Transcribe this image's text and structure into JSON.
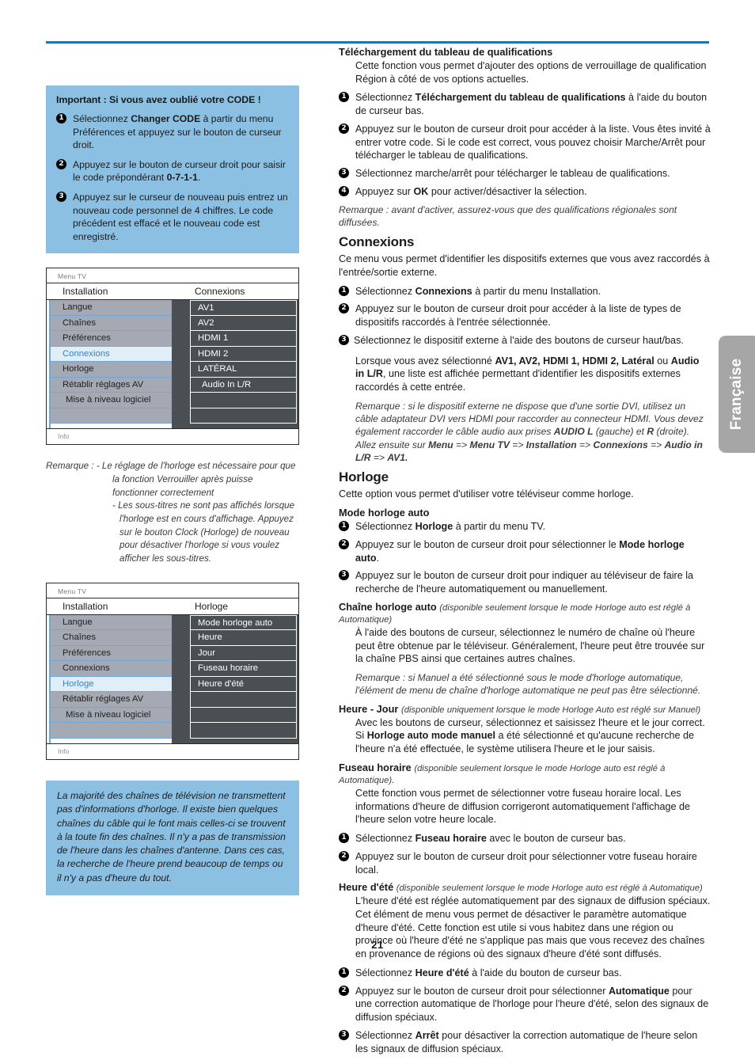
{
  "page": {
    "number": "21",
    "side_tab": "Française"
  },
  "left_column": {
    "code_box": {
      "title": "Important : Si vous avez oublié votre CODE !",
      "steps": [
        "Sélectionnez <b>Changer CODE</b> à partir du menu Préférences et appuyez sur le bouton de curseur droit.",
        "Appuyez sur le bouton de curseur droit pour saisir le code prépondérant <b>0-7-1-1</b>.",
        "Appuyez sur le curseur de nouveau puis entrez un nouveau code personnel de 4 chiffres. Le code précédent est effacé et le nouveau code est enregistré."
      ]
    },
    "menu_connexions": {
      "top_label": "Menu TV",
      "header_left": "Installation",
      "header_right": "Connexions",
      "left_items": [
        "Langue",
        "Chaînes",
        "Préférences",
        "Connexions",
        "Horloge",
        "Rétablir réglages AV",
        "Mise à niveau logiciel",
        ""
      ],
      "selected_left": "Connexions",
      "right_items": [
        "AV1",
        "AV2",
        "HDMI 1",
        "HDMI 2",
        "LATÉRAL",
        "Audio In L/R",
        "",
        ""
      ],
      "bottom_label": "Info"
    },
    "clock_note": {
      "label": "Remarque :",
      "items": [
        "- Le réglage de l'horloge est nécessaire pour que la fonction Verrouiller après puisse fonctionner correctement",
        "- Les sous-titres ne sont pas affichés lorsque l'horloge est en cours d'affichage. Appuyez sur le bouton Clock (Horloge) de nouveau pour désactiver l'horloge si vous voulez afficher les sous-titres."
      ]
    },
    "menu_horloge": {
      "top_label": "Menu TV",
      "header_left": "Installation",
      "header_right": "Horloge",
      "left_items": [
        "Langue",
        "Chaînes",
        "Préférences",
        "Connexions",
        "Horloge",
        "Rétablir réglages AV",
        "Mise à niveau logiciel",
        ""
      ],
      "selected_left": "Horloge",
      "right_items": [
        "Mode horloge auto",
        "Heure",
        "Jour",
        "Fuseau horaire",
        "Heure d'été",
        "",
        "",
        ""
      ],
      "bottom_label": "Info"
    },
    "broadcast_box": {
      "text": "La majorité des chaînes de télévision ne transmettent pas d'informations d'horloge. Il existe bien quelques chaînes du câble qui le font mais celles-ci se trouvent à la toute fin des chaînes. Il n'y a pas de transmission de l'heure dans les chaînes d'antenne. Dans ces cas, la recherche de l'heure prend beaucoup de temps ou il n'y a pas d'heure du tout."
    }
  },
  "right_column": {
    "ratings": {
      "heading": "Téléchargement du tableau de qualifications",
      "intro": "Cette fonction vous permet d'ajouter des options de verrouillage de qualification Région à côté de vos options actuelles.",
      "steps": [
        "Sélectionnez <b>Téléchargement du tableau de qualifications</b> à l'aide du bouton de curseur bas.",
        "Appuyez sur le bouton de curseur droit pour accéder à la liste. Vous êtes invité à entrer votre code. Si le code est correct, vous pouvez choisir Marche/Arrêt pour télécharger le tableau de qualifications.",
        "Sélectionnez marche/arrêt pour télécharger le tableau de qualifications.",
        "Appuyez sur <b>OK</b> pour activer/désactiver la sélection."
      ],
      "note": "Remarque : avant d'activer, assurez-vous que des qualifications régionales sont diffusées."
    },
    "connexions": {
      "heading": "Connexions",
      "intro": "Ce menu vous permet d'identifier les dispositifs externes que vous avez raccordés à l'entrée/sortie externe.",
      "steps": [
        "Sélectionnez <b>Connexions</b> à partir du menu Installation.",
        "Appuyez sur le bouton de curseur droit pour accéder à la liste de types de dispositifs raccordés à l'entrée sélectionnée.",
        "Sélectionnez le dispositif externe à l'aide des boutons de curseur haut/bas."
      ],
      "body": "Lorsque vous avez sélectionné <b>AV1, AV2, HDMI 1, HDMI 2, Latéral</b> ou <b>Audio in L/R</b>, une liste est affichée permettant d'identifier les dispositifs externes raccordés à cette entrée.",
      "note": "Remarque : si le dispositif externe ne dispose que d'une sortie DVI, utilisez un câble adaptateur DVI vers HDMI pour raccorder au connecteur HDMI. Vous devez également raccorder le câble audio aux prises <b>AUDIO L</b> (gauche) et <b>R</b> (droite). Allez ensuite sur <b>Menu</b> =&gt; <b>Menu TV</b> =&gt; <b>Installation</b> =&gt; <b>Connexions</b> =&gt; <b>Audio in L/R</b> =&gt; <b>AV1.</b>"
    },
    "horloge": {
      "heading": "Horloge",
      "intro": "Cette option vous permet d'utiliser votre téléviseur comme horloge.",
      "mode_auto": {
        "heading": "Mode horloge auto",
        "steps": [
          "Sélectionnez <b>Horloge</b> à partir du menu TV.",
          "Appuyez sur le bouton de curseur droit pour sélectionner le <b>Mode horloge auto</b>.",
          "Appuyez sur le bouton de curseur droit pour indiquer au téléviseur de faire la recherche de l'heure automatiquement ou manuellement."
        ]
      },
      "chaine_auto": {
        "heading": "Chaîne horloge auto",
        "heading_note": "(disponible seulement lorsque le mode Horloge auto est réglé à Automatique)",
        "body": "À l'aide des boutons de curseur, sélectionnez le numéro de chaîne où l'heure peut être obtenue par le téléviseur. Généralement, l'heure peut être trouvée sur la chaîne PBS ainsi que certaines autres chaînes.",
        "note": "Remarque : si Manuel a été sélectionné sous le mode d'horloge automatique, l'élément de menu de chaîne d'horloge automatique ne peut pas être sélectionné."
      },
      "heure_jour": {
        "heading": "Heure - Jour",
        "heading_note": "(disponible uniquement lorsque le mode Horloge Auto est réglé sur Manuel)",
        "body": "Avec les boutons de curseur, sélectionnez et saisissez l'heure et le jour correct. Si <b>Horloge auto mode manuel</b> a été sélectionné et qu'aucune recherche de l'heure n'a été effectuée, le système utilisera l'heure et le jour saisis."
      },
      "fuseau": {
        "heading": "Fuseau horaire",
        "heading_note": "(disponible seulement lorsque le mode Horloge auto est réglé à Automatique).",
        "body": "Cette fonction vous permet de sélectionner votre fuseau horaire local. Les informations d'heure de diffusion corrigeront automatiquement l'affichage de l'heure selon votre heure locale.",
        "steps": [
          "Sélectionnez <b>Fuseau horaire</b> avec le bouton de curseur bas.",
          "Appuyez sur le bouton de curseur droit pour sélectionner votre fuseau horaire local."
        ]
      },
      "heure_ete": {
        "heading": "Heure d'été",
        "heading_note": "(disponible seulement lorsque le mode Horloge auto est réglé à Automatique)",
        "body": "L'heure d'été est réglée automatiquement par des signaux de diffusion spéciaux. Cet élément de menu vous permet de désactiver le paramètre automatique d'heure d'été. Cette fonction est utile si vous habitez dans une région ou province où l'heure d'été ne s'applique pas mais que vous recevez des chaînes en provenance de régions où des signaux d'heure d'été sont diffusés.",
        "steps": [
          "Sélectionnez <b>Heure d'été</b> à l'aide du bouton de curseur bas.",
          "Appuyez sur le bouton de curseur droit pour sélectionner <b>Automatique</b> pour une correction automatique de l'horloge pour l'heure d'été, selon des signaux de diffusion spéciaux.",
          "Sélectionnez <b>Arrêt</b> pour désactiver la correction automatique de l'heure selon les signaux de diffusion spéciaux."
        ]
      }
    }
  }
}
